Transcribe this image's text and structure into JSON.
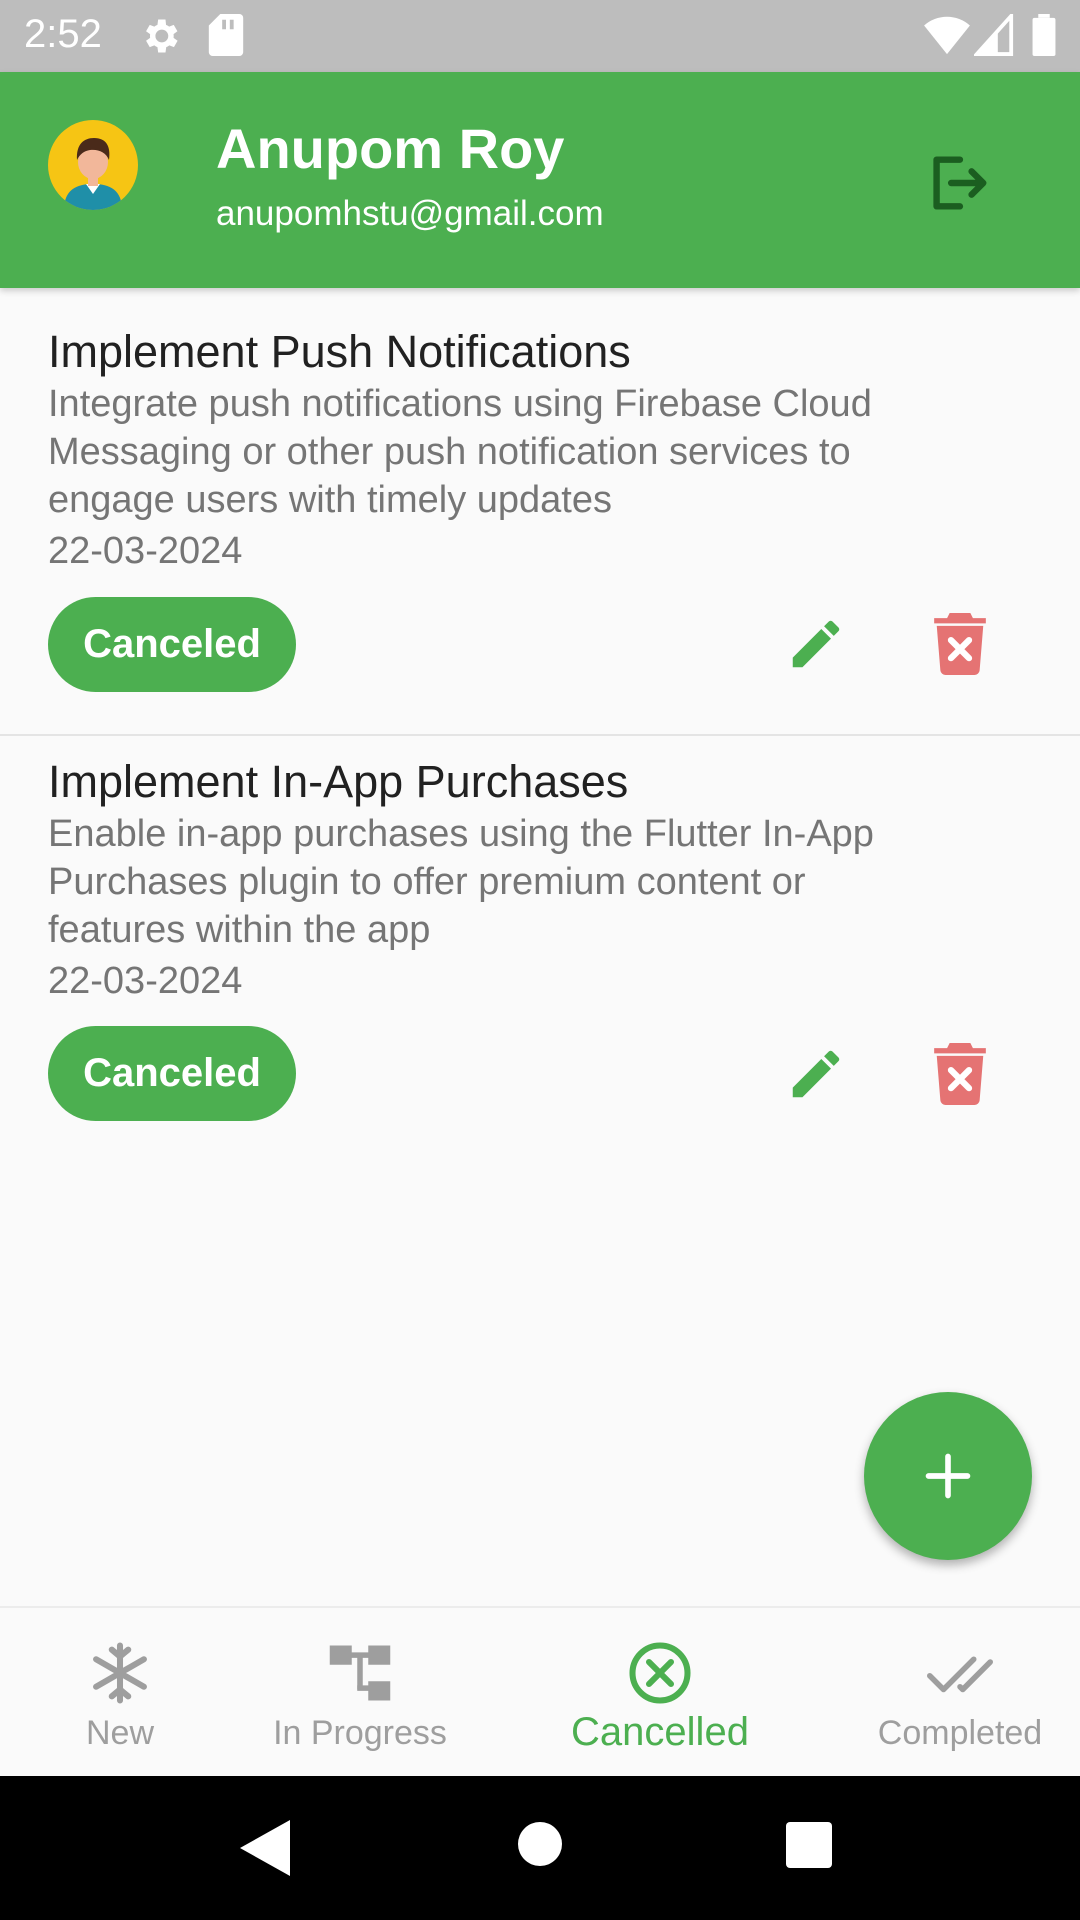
{
  "status_bar": {
    "time": "2:52",
    "icons": [
      "gear-icon",
      "sd-card-icon",
      "wifi-icon",
      "cell-signal-icon",
      "battery-icon"
    ]
  },
  "header": {
    "name": "Anupom Roy",
    "email": "anupomhstu@gmail.com",
    "avatar_icon": "user-avatar-icon",
    "logout_icon": "logout-icon"
  },
  "tasks": [
    {
      "title": "Implement Push Notifications",
      "desc_lines": [
        "Integrate push notifications using Firebase Cloud",
        "Messaging or other push notification services to",
        "engage users with timely updates"
      ],
      "date": "22-03-2024",
      "status": "Canceled"
    },
    {
      "title": "Implement In-App Purchases",
      "desc_lines": [
        "Enable in-app purchases using the Flutter In-App",
        "Purchases plugin to offer premium content or",
        "features within the app"
      ],
      "date": "22-03-2024",
      "status": "Canceled"
    }
  ],
  "fab": {
    "icon": "plus-icon"
  },
  "bottom_nav": {
    "active_index": 2,
    "items": [
      {
        "label": "New",
        "icon": "snowflake-icon"
      },
      {
        "label": "In Progress",
        "icon": "hierarchy-icon"
      },
      {
        "label": "Cancelled",
        "icon": "cancel-circle-icon"
      },
      {
        "label": "Completed",
        "icon": "double-check-icon"
      }
    ]
  },
  "system_nav": {
    "icons": [
      "back-icon",
      "home-icon",
      "recents-icon"
    ]
  },
  "colors": {
    "primary": "#4caf50",
    "delete": "#e57373",
    "status_bar": "#bdbdbd",
    "inactive_nav": "#9e9e9e",
    "logout_icon": "#1b5e20"
  }
}
